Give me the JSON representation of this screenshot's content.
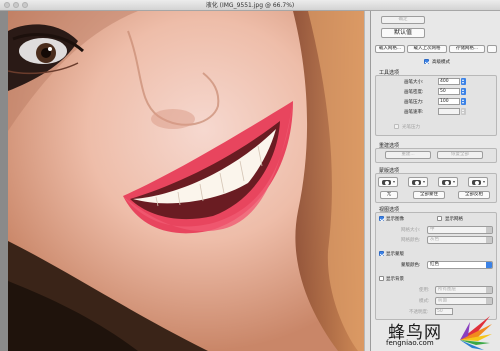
{
  "window": {
    "title": "液化 (IMG_9551.jpg @ 66.7%)"
  },
  "actions": {
    "ok_label": "确定",
    "default_label": "默认值"
  },
  "mesh_buttons": {
    "load_mesh": "载入网格...",
    "load_last": "载入上次网格",
    "save_mesh": "存储网格..."
  },
  "advanced_mode": {
    "label": "高级模式",
    "checked": true
  },
  "tool_options": {
    "title": "工具选项",
    "brush_size": {
      "label": "画笔大小:",
      "value": "400"
    },
    "brush_density": {
      "label": "画笔密度:",
      "value": "50"
    },
    "brush_pressure": {
      "label": "画笔压力:",
      "value": "100"
    },
    "brush_rate": {
      "label": "画笔速率:",
      "value": ""
    },
    "stylus_pressure": {
      "label": "光笔压力",
      "checked": false
    }
  },
  "reconstruct": {
    "title": "重建选项",
    "rebuild_label": "重建...",
    "restore_all_label": "恢复全部"
  },
  "mask_options": {
    "title": "蒙版选项",
    "none_label": "无",
    "mask_all_label": "全部蒙住",
    "invert_all_label": "全部反相"
  },
  "view_options": {
    "title": "视图选项",
    "show_image": {
      "label": "显示图像",
      "checked": true
    },
    "show_mesh": {
      "label": "显示网格",
      "checked": false
    },
    "mesh_size": {
      "label": "网格大小:",
      "value": "中"
    },
    "mesh_color": {
      "label": "网格颜色:",
      "value": "灰色"
    },
    "show_mask": {
      "label": "显示蒙版",
      "checked": true
    },
    "mask_color": {
      "label": "蒙版颜色:",
      "value": "红色"
    },
    "show_backdrop": {
      "label": "显示背景",
      "checked": false
    },
    "use": {
      "label": "使用:",
      "value": "所有图层"
    },
    "mode": {
      "label": "模式:",
      "value": "前面"
    },
    "opacity": {
      "label": "不透明度:",
      "value": "50"
    }
  },
  "watermark": {
    "brand": "蜂鸟网",
    "url": "fengniao.com"
  },
  "colors": {
    "accent": "#3b82e6",
    "lips": "#e8455e"
  }
}
